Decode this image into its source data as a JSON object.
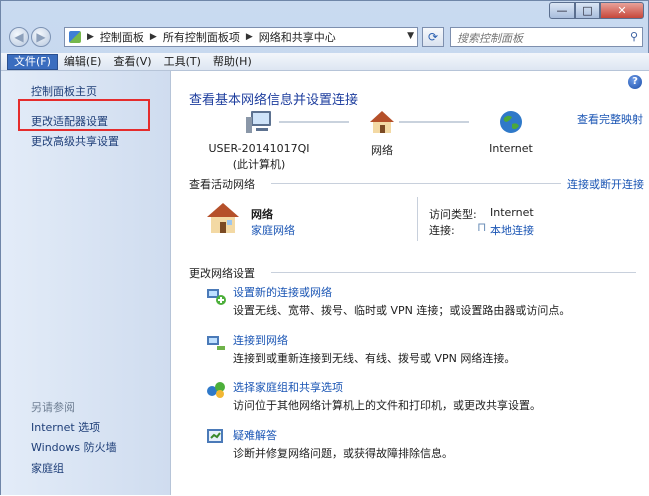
{
  "window": {
    "minimize": "—",
    "maximize": "□",
    "close": "✕"
  },
  "address": {
    "crumbs": [
      "控制面板",
      "所有控制面板项",
      "网络和共享中心"
    ],
    "search_placeholder": "搜索控制面板"
  },
  "menu": [
    "文件(F)",
    "编辑(E)",
    "查看(V)",
    "工具(T)",
    "帮助(H)"
  ],
  "sidebar": {
    "items": [
      "控制面板主页",
      "更改适配器设置",
      "更改高级共享设置"
    ],
    "see_also_title": "另请参阅",
    "see_also": [
      "Internet 选项",
      "Windows 防火墙",
      "家庭组"
    ]
  },
  "main": {
    "title": "查看基本网络信息并设置连接",
    "full_map": "查看完整映射",
    "nodes": [
      {
        "label": "USER-20141017QI",
        "sub": "(此计算机)"
      },
      {
        "label": "网络",
        "sub": ""
      },
      {
        "label": "Internet",
        "sub": ""
      }
    ],
    "active_title": "查看活动网络",
    "connect_link": "连接或断开连接",
    "network_name": "网络",
    "network_type": "家庭网络",
    "access_type_label": "访问类型:",
    "access_type_value": "Internet",
    "connection_label": "连接:",
    "connection_value": "本地连接",
    "change_title": "更改网络设置",
    "tasks": [
      {
        "title": "设置新的连接或网络",
        "desc": "设置无线、宽带、拨号、临时或 VPN 连接；或设置路由器或访问点。"
      },
      {
        "title": "连接到网络",
        "desc": "连接到或重新连接到无线、有线、拨号或 VPN 网络连接。"
      },
      {
        "title": "选择家庭组和共享选项",
        "desc": "访问位于其他网络计算机上的文件和打印机，或更改共享设置。"
      },
      {
        "title": "疑难解答",
        "desc": "诊断并修复网络问题，或获得故障排除信息。"
      }
    ]
  },
  "colors": {
    "link": "#1a55b4",
    "title": "#1e3e9e",
    "highlight_box": "#e52c2c"
  }
}
